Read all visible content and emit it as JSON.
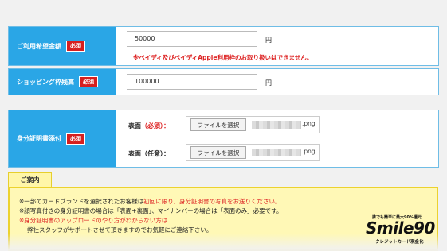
{
  "rows": {
    "amount": {
      "label": "ご利用希望金額",
      "required": "必須",
      "value": "50000",
      "unit": "円",
      "warning": "※ペイディ及びペイディApple利用枠のお取り扱いはできません。"
    },
    "shopping": {
      "label": "ショッピング枠残高",
      "required": "必須",
      "value": "100000",
      "unit": "円"
    },
    "id_docs": {
      "label": "身分証明書添付",
      "required": "必須",
      "front_label": "表面",
      "front_note": "（必須）：",
      "back_label": "表面（任意）：",
      "file_button": "ファイルを選択",
      "file_ext": ".png"
    }
  },
  "guide": {
    "tab": "ご案内",
    "line1_a": "※一部のカードブランドを選択されたお客様は",
    "line1_b": "初回に限り、身分証明書の写真をお送りください。",
    "line2": "※顔写真付きの身分証明書の場合は「表面+裏面」、マイナンバーの場合は「表面のみ」必要です。",
    "line3": "※身分証明書のアップロードのやり方がわからない方は",
    "line4": "弊社スタッフがサポートさせて頂きますのでお気軽にご連絡下さい。"
  },
  "logo": {
    "tagline": "誰でも簡単に最大90%還元",
    "word": "Smile90",
    "sub": "クレジットカード現金化"
  }
}
